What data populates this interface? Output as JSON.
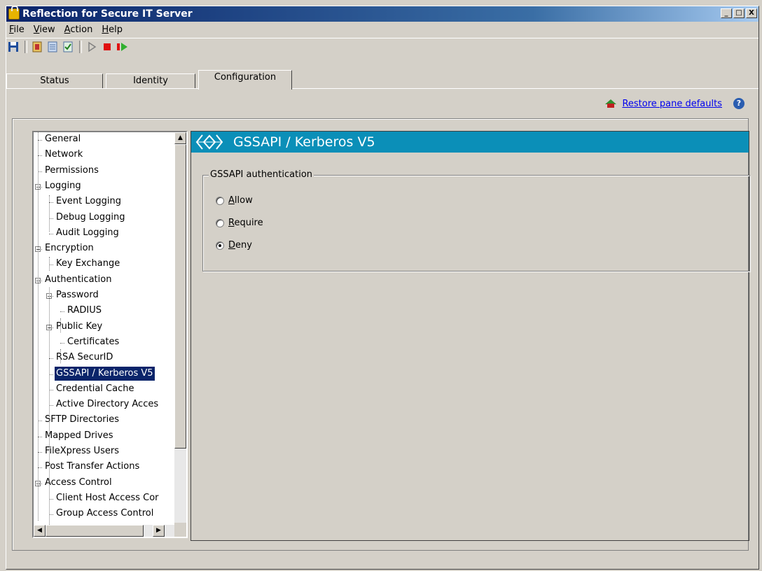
{
  "window": {
    "title": "Reflection for Secure IT Server",
    "controls": [
      "_",
      "□",
      "X"
    ]
  },
  "menu": [
    {
      "label": "File",
      "mnemonic": "F"
    },
    {
      "label": "View",
      "mnemonic": "V"
    },
    {
      "label": "Action",
      "mnemonic": "A"
    },
    {
      "label": "Help",
      "mnemonic": "H"
    }
  ],
  "toolbar": {
    "icons": [
      "save-icon",
      "settings-icon",
      "list-icon",
      "check-icon",
      "play-icon",
      "stop-icon",
      "restart-icon"
    ]
  },
  "tabs": [
    "Status",
    "Identity",
    "Configuration"
  ],
  "active_tab": "Configuration",
  "restore_link": "Restore pane defaults",
  "tree": {
    "items": [
      {
        "label": "General",
        "level": 0
      },
      {
        "label": "Network",
        "level": 0
      },
      {
        "label": "Permissions",
        "level": 0
      },
      {
        "label": "Logging",
        "level": 0,
        "expanded": true
      },
      {
        "label": "Event Logging",
        "level": 1
      },
      {
        "label": "Debug Logging",
        "level": 1
      },
      {
        "label": "Audit Logging",
        "level": 1
      },
      {
        "label": "Encryption",
        "level": 0,
        "expanded": true
      },
      {
        "label": "Key Exchange",
        "level": 1
      },
      {
        "label": "Authentication",
        "level": 0,
        "expanded": true
      },
      {
        "label": "Password",
        "level": 1,
        "expanded": true
      },
      {
        "label": "RADIUS",
        "level": 2
      },
      {
        "label": "Public Key",
        "level": 1,
        "expanded": true
      },
      {
        "label": "Certificates",
        "level": 2
      },
      {
        "label": "RSA SecurID",
        "level": 1
      },
      {
        "label": "GSSAPI / Kerberos V5",
        "level": 1,
        "selected": true
      },
      {
        "label": "Credential Cache",
        "level": 1
      },
      {
        "label": "Active Directory Acces",
        "level": 1
      },
      {
        "label": "SFTP Directories",
        "level": 0
      },
      {
        "label": "Mapped Drives",
        "level": 0
      },
      {
        "label": "FileXpress Users",
        "level": 0
      },
      {
        "label": "Post Transfer Actions",
        "level": 0
      },
      {
        "label": "Access Control",
        "level": 0,
        "expanded": true
      },
      {
        "label": "Client Host Access Cor",
        "level": 1
      },
      {
        "label": "Group Access Control",
        "level": 1
      }
    ]
  },
  "pane": {
    "title": "GSSAPI / Kerberos V5",
    "group_label": "GSSAPI authentication",
    "options": [
      {
        "label": "Allow",
        "mnemonic": "A",
        "checked": false
      },
      {
        "label": "Require",
        "mnemonic": "R",
        "checked": false
      },
      {
        "label": "Deny",
        "mnemonic": "D",
        "checked": true
      }
    ]
  },
  "colors": {
    "banner": "#0b8fb8",
    "selection": "#0a246a",
    "face": "#d4d0c8"
  }
}
